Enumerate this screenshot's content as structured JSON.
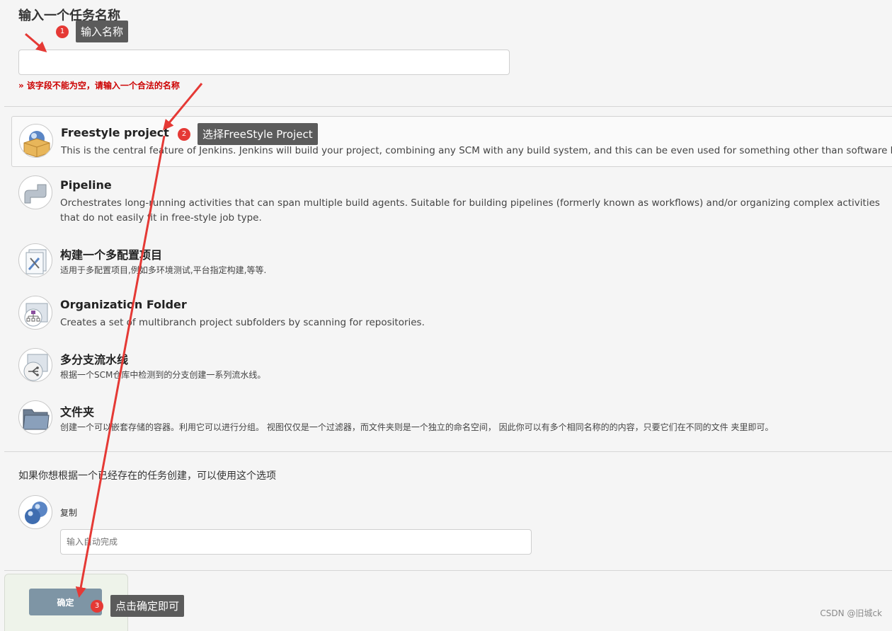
{
  "header": {
    "title": "输入一个任务名称",
    "name_value": "",
    "error": "» 该字段不能为空，请输入一个合法的名称"
  },
  "items": [
    {
      "title": "Freestyle project",
      "desc": "This is the central feature of Jenkins. Jenkins will build your project, combining any SCM with any build system, and this can be even used for something other than software build.",
      "icon": "freestyle-box-icon",
      "selected": true
    },
    {
      "title": "Pipeline",
      "desc": "Orchestrates long-running activities that can span multiple build agents. Suitable for building pipelines (formerly known as workflows) and/or organizing complex activities that do not easily fit in free-style job type.",
      "icon": "pipeline-icon"
    },
    {
      "title": "构建一个多配置项目",
      "desc": "适用于多配置项目,例如多环境测试,平台指定构建,等等.",
      "icon": "multi-config-icon"
    },
    {
      "title": "Organization Folder",
      "desc": "Creates a set of multibranch project subfolders by scanning for repositories.",
      "icon": "organization-folder-icon"
    },
    {
      "title": "多分支流水线",
      "desc": "根据一个SCM仓库中检测到的分支创建一系列流水线。",
      "icon": "multibranch-icon"
    },
    {
      "title": "文件夹",
      "desc": "创建一个可以嵌套存储的容器。利用它可以进行分组。 视图仅仅是一个过滤器，而文件夹则是一个独立的命名空间， 因此你可以有多个相同名称的的内容，只要它们在不同的文件 夹里即可。",
      "icon": "folder-icon"
    }
  ],
  "copy": {
    "label": "如果你想根据一个已经存在的任务创建，可以使用这个选项",
    "text": "复制",
    "placeholder": "输入自动完成"
  },
  "footer": {
    "ok_label": "确定"
  },
  "annotations": [
    {
      "num": "1",
      "text": "输入名称"
    },
    {
      "num": "2",
      "text": "选择FreeStyle Project"
    },
    {
      "num": "3",
      "text": "点击确定即可"
    }
  ],
  "watermark": "CSDN @旧城ck",
  "colors": {
    "error": "#cc0000",
    "arrow": "#e53935",
    "button": "#7e95a5",
    "callout": "#5b5b5b"
  }
}
